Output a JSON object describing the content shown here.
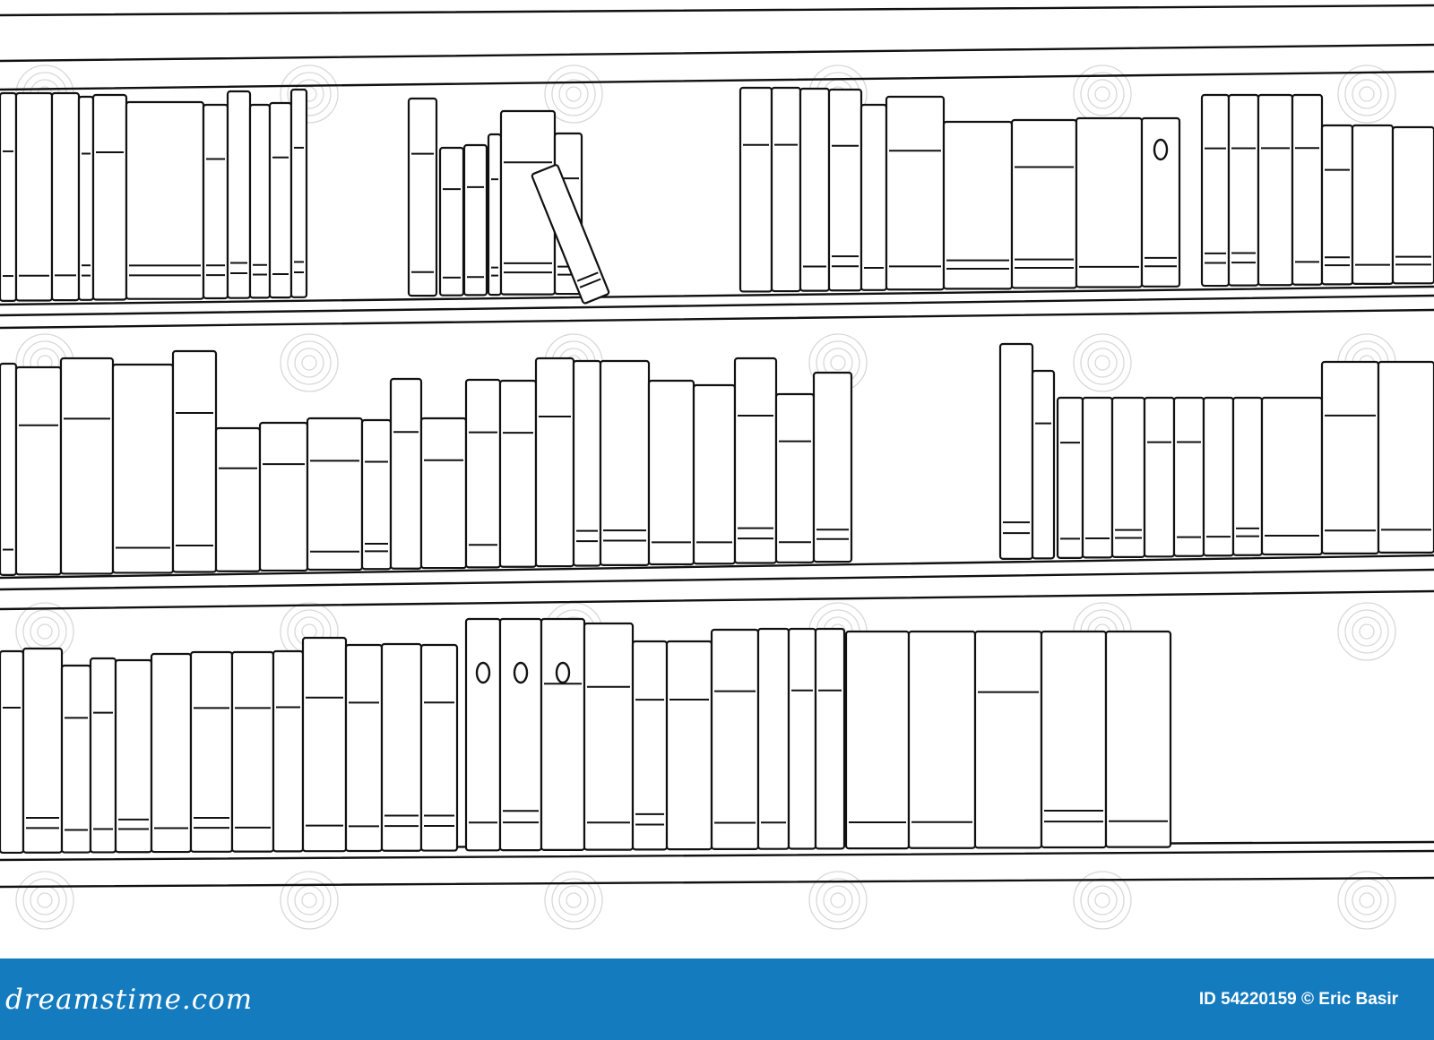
{
  "footer": {
    "brand": "dreamstime.com",
    "stock_id": "ID 54220159",
    "credit": "© Eric Basir"
  },
  "illustration": {
    "subject": "bookshelf line drawing",
    "shelves": [
      {
        "book_count": 30
      },
      {
        "book_count": 32
      },
      {
        "book_count": 29
      }
    ]
  },
  "colors": {
    "footer_bg": "#157bbf",
    "line": "#111111",
    "background": "#ffffff"
  }
}
